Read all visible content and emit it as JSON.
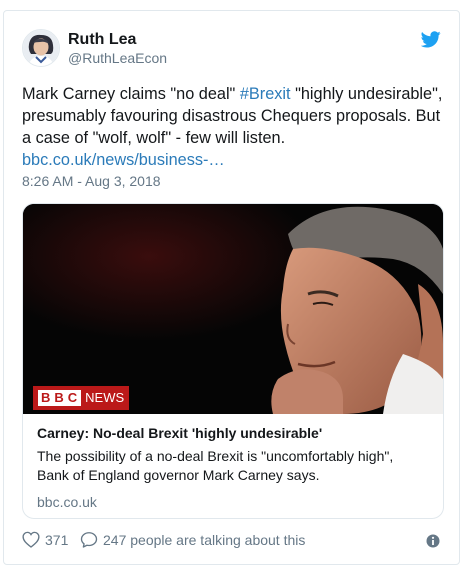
{
  "author": {
    "name": "Ruth Lea",
    "handle": "@RuthLeaEcon"
  },
  "tweet": {
    "text_part1": "Mark Carney claims \"no deal\" ",
    "hashtag": "#Brexit",
    "text_part2": " \"highly undesirable\", presumably favouring disastrous Chequers proposals. But a case of \"wolf, wolf\" - few will listen. ",
    "link": "bbc.co.uk/news/business-…",
    "timestamp": "8:26 AM - Aug 3, 2018"
  },
  "card": {
    "logo_text": "BBC",
    "logo_suffix": "NEWS",
    "title": "Carney: No-deal Brexit 'highly undesirable'",
    "description": "The possibility of a no-deal Brexit is \"uncomfortably high\", Bank of England governor Mark Carney says.",
    "domain": "bbc.co.uk"
  },
  "actions": {
    "likes": "371",
    "comments_text": "247 people are talking about this"
  },
  "icons": {
    "brand_color": "#1da1f2",
    "bbc_red": "#bb1919"
  }
}
